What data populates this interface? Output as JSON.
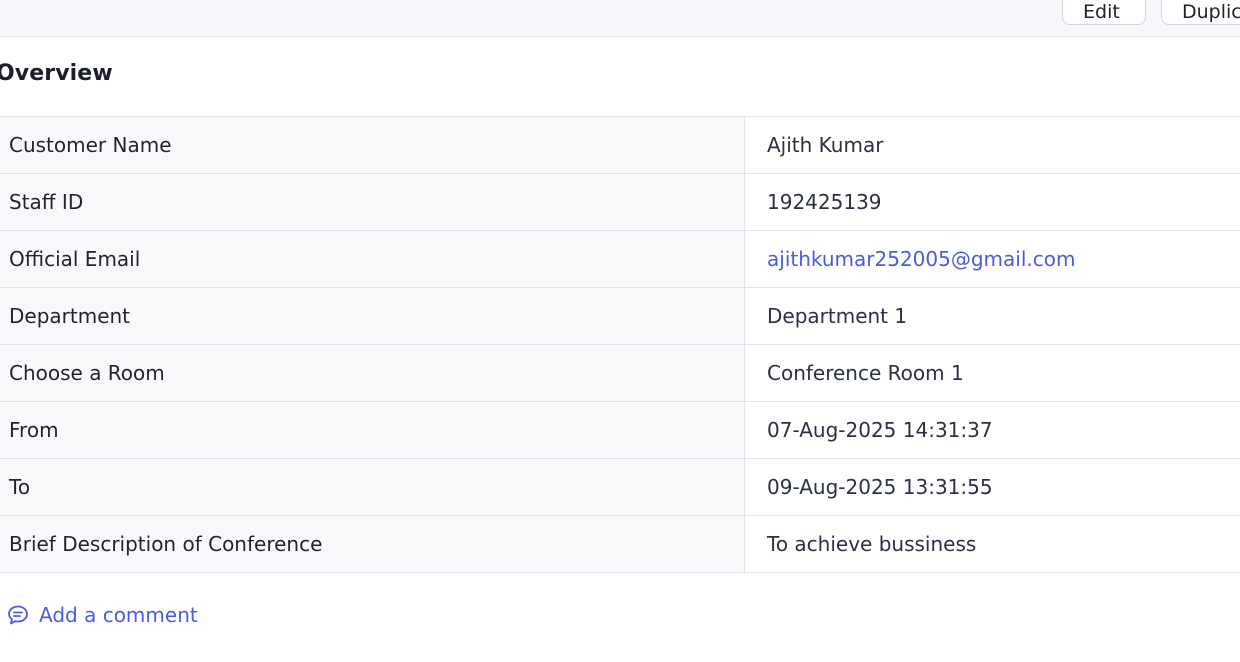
{
  "toolbar": {
    "edit_label": "Edit",
    "duplicate_label": "Duplicate"
  },
  "section": {
    "title": "Overview"
  },
  "details": [
    {
      "label": "Customer Name",
      "value": "Ajith Kumar"
    },
    {
      "label": "Staff ID",
      "value": "192425139"
    },
    {
      "label": "Official Email",
      "value": "ajithkumar252005@gmail.com"
    },
    {
      "label": "Department",
      "value": "Department 1"
    },
    {
      "label": "Choose a Room",
      "value": "Conference Room 1"
    },
    {
      "label": "From",
      "value": "07-Aug-2025 14:31:37"
    },
    {
      "label": "To",
      "value": "09-Aug-2025 13:31:55"
    },
    {
      "label": "Brief Description of Conference",
      "value": "To achieve bussiness"
    }
  ],
  "comment": {
    "label": "Add a comment",
    "icon": "comment-icon"
  },
  "colors": {
    "accent": "#4a5ce0",
    "label_bg": "#f9f9fc",
    "border": "#e3e4ea"
  }
}
